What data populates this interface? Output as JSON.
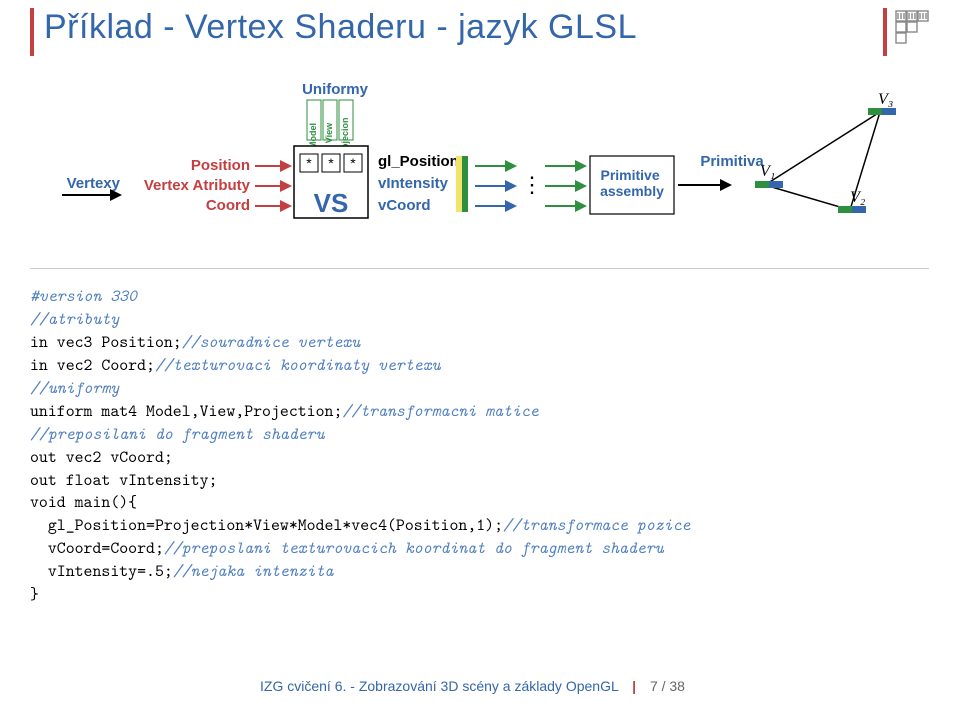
{
  "title": "Příklad - Vertex Shaderu - jazyk GLSL",
  "diagram": {
    "vertexy": "Vertexy",
    "position": "Position",
    "vertex_atributy": "Vertex Atributy",
    "coord": "Coord",
    "uniformlabel": "Uniformy",
    "u1": "Model",
    "u2": "View",
    "u3": "Projecion",
    "vs": "VS",
    "out1": "gl_Position",
    "out2": "vIntensity",
    "out3": "vCoord",
    "prim_assembly": "Primitive assembly",
    "primitiva": "Primitiva",
    "v1": "V₁",
    "v2": "V₂",
    "v3": "V₃",
    "dots": "⋮"
  },
  "code": {
    "l01a": "#version 330",
    "l02c": "//atributy",
    "l03a": "in vec3 Position;",
    "l03c": "//souradnice vertexu",
    "l04a": "in vec2 Coord;",
    "l04c": "//texturovaci koordinaty vertexu",
    "l05c": "//uniformy",
    "l06a": "uniform mat4 Model,View,Projection;",
    "l06c": "//transformacni matice",
    "l07c": "//preposilani do fragment shaderu",
    "l08a": "out vec2 vCoord;",
    "l09a": "out float vIntensity;",
    "l10a": "void main(){",
    "l11a": "  gl_Position=Projection*View*Model*vec4(Position,1);",
    "l11c": "//transformace pozice",
    "l12a": "  vCoord=Coord;",
    "l12c": "//preposlani texturovacich koordinat do fragment shaderu",
    "l13a": "  vIntensity=.5;",
    "l13c": "//nejaka intenzita",
    "l14a": "}"
  },
  "footer": {
    "title": "IZG cvičení 6. - Zobrazování 3D scény a základy OpenGL",
    "page": "7 / 38"
  }
}
